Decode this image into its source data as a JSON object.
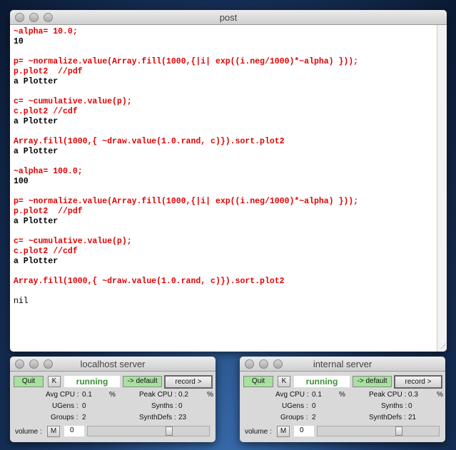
{
  "post": {
    "title": "post",
    "lines": [
      {
        "text": "~alpha= 10.0;",
        "color": "#e00000"
      },
      {
        "text": "10",
        "color": "#000000"
      },
      {
        "text": "",
        "color": "#000000"
      },
      {
        "text": "p= ~normalize.value(Array.fill(1000,{|i| exp((i.neg/1000)*~alpha) }));",
        "color": "#e00000"
      },
      {
        "text": "p.plot2  //pdf",
        "color": "#e00000"
      },
      {
        "text": "a Plotter",
        "color": "#000000"
      },
      {
        "text": "",
        "color": "#000000"
      },
      {
        "text": "c= ~cumulative.value(p);",
        "color": "#e00000"
      },
      {
        "text": "c.plot2 //cdf",
        "color": "#e00000"
      },
      {
        "text": "a Plotter",
        "color": "#000000"
      },
      {
        "text": "",
        "color": "#000000"
      },
      {
        "text": "Array.fill(1000,{ ~draw.value(1.0.rand, c)}).sort.plot2",
        "color": "#e00000"
      },
      {
        "text": "a Plotter",
        "color": "#000000"
      },
      {
        "text": "",
        "color": "#000000"
      },
      {
        "text": "~alpha= 100.0;",
        "color": "#e00000"
      },
      {
        "text": "100",
        "color": "#000000"
      },
      {
        "text": "",
        "color": "#000000"
      },
      {
        "text": "p= ~normalize.value(Array.fill(1000,{|i| exp((i.neg/1000)*~alpha) }));",
        "color": "#e00000"
      },
      {
        "text": "p.plot2  //pdf",
        "color": "#e00000"
      },
      {
        "text": "a Plotter",
        "color": "#000000"
      },
      {
        "text": "",
        "color": "#000000"
      },
      {
        "text": "c= ~cumulative.value(p);",
        "color": "#e00000"
      },
      {
        "text": "c.plot2 //cdf",
        "color": "#e00000"
      },
      {
        "text": "a Plotter",
        "color": "#000000"
      },
      {
        "text": "",
        "color": "#000000"
      },
      {
        "text": "Array.fill(1000,{ ~draw.value(1.0.rand, c)}).sort.plot2",
        "color": "#e00000"
      },
      {
        "text": "",
        "color": "#000000"
      },
      {
        "text": "nil",
        "color": "#000000",
        "normal": true
      }
    ]
  },
  "servers": [
    {
      "title": "localhost server",
      "quit": "Quit",
      "k": "K",
      "status": "running",
      "default": "-> default",
      "record": "record >",
      "avg_cpu_label": "Avg CPU :",
      "avg_cpu": "0.1",
      "pct": "%",
      "peak_cpu_label": "Peak CPU :",
      "peak_cpu": "0.2",
      "ugens_label": "UGens :",
      "ugens": "0",
      "synths_label": "Synths :",
      "synths": "0",
      "groups_label": "Groups :",
      "groups": "2",
      "synthdefs_label": "SynthDefs :",
      "synthdefs": "23",
      "volume_label": "volume :",
      "mute": "M",
      "volume": "0",
      "volume_slider": 0.68
    },
    {
      "title": "internal server",
      "quit": "Quit",
      "k": "K",
      "status": "running",
      "default": "-> default",
      "record": "record >",
      "avg_cpu_label": "Avg CPU :",
      "avg_cpu": "0.1",
      "pct": "%",
      "peak_cpu_label": "Peak CPU :",
      "peak_cpu": "0.3",
      "ugens_label": "UGens :",
      "ugens": "0",
      "synths_label": "Synths :",
      "synths": "0",
      "groups_label": "Groups :",
      "groups": "2",
      "synthdefs_label": "SynthDefs :",
      "synthdefs": "21",
      "volume_label": "volume :",
      "mute": "M",
      "volume": "0",
      "volume_slider": 0.68
    }
  ]
}
